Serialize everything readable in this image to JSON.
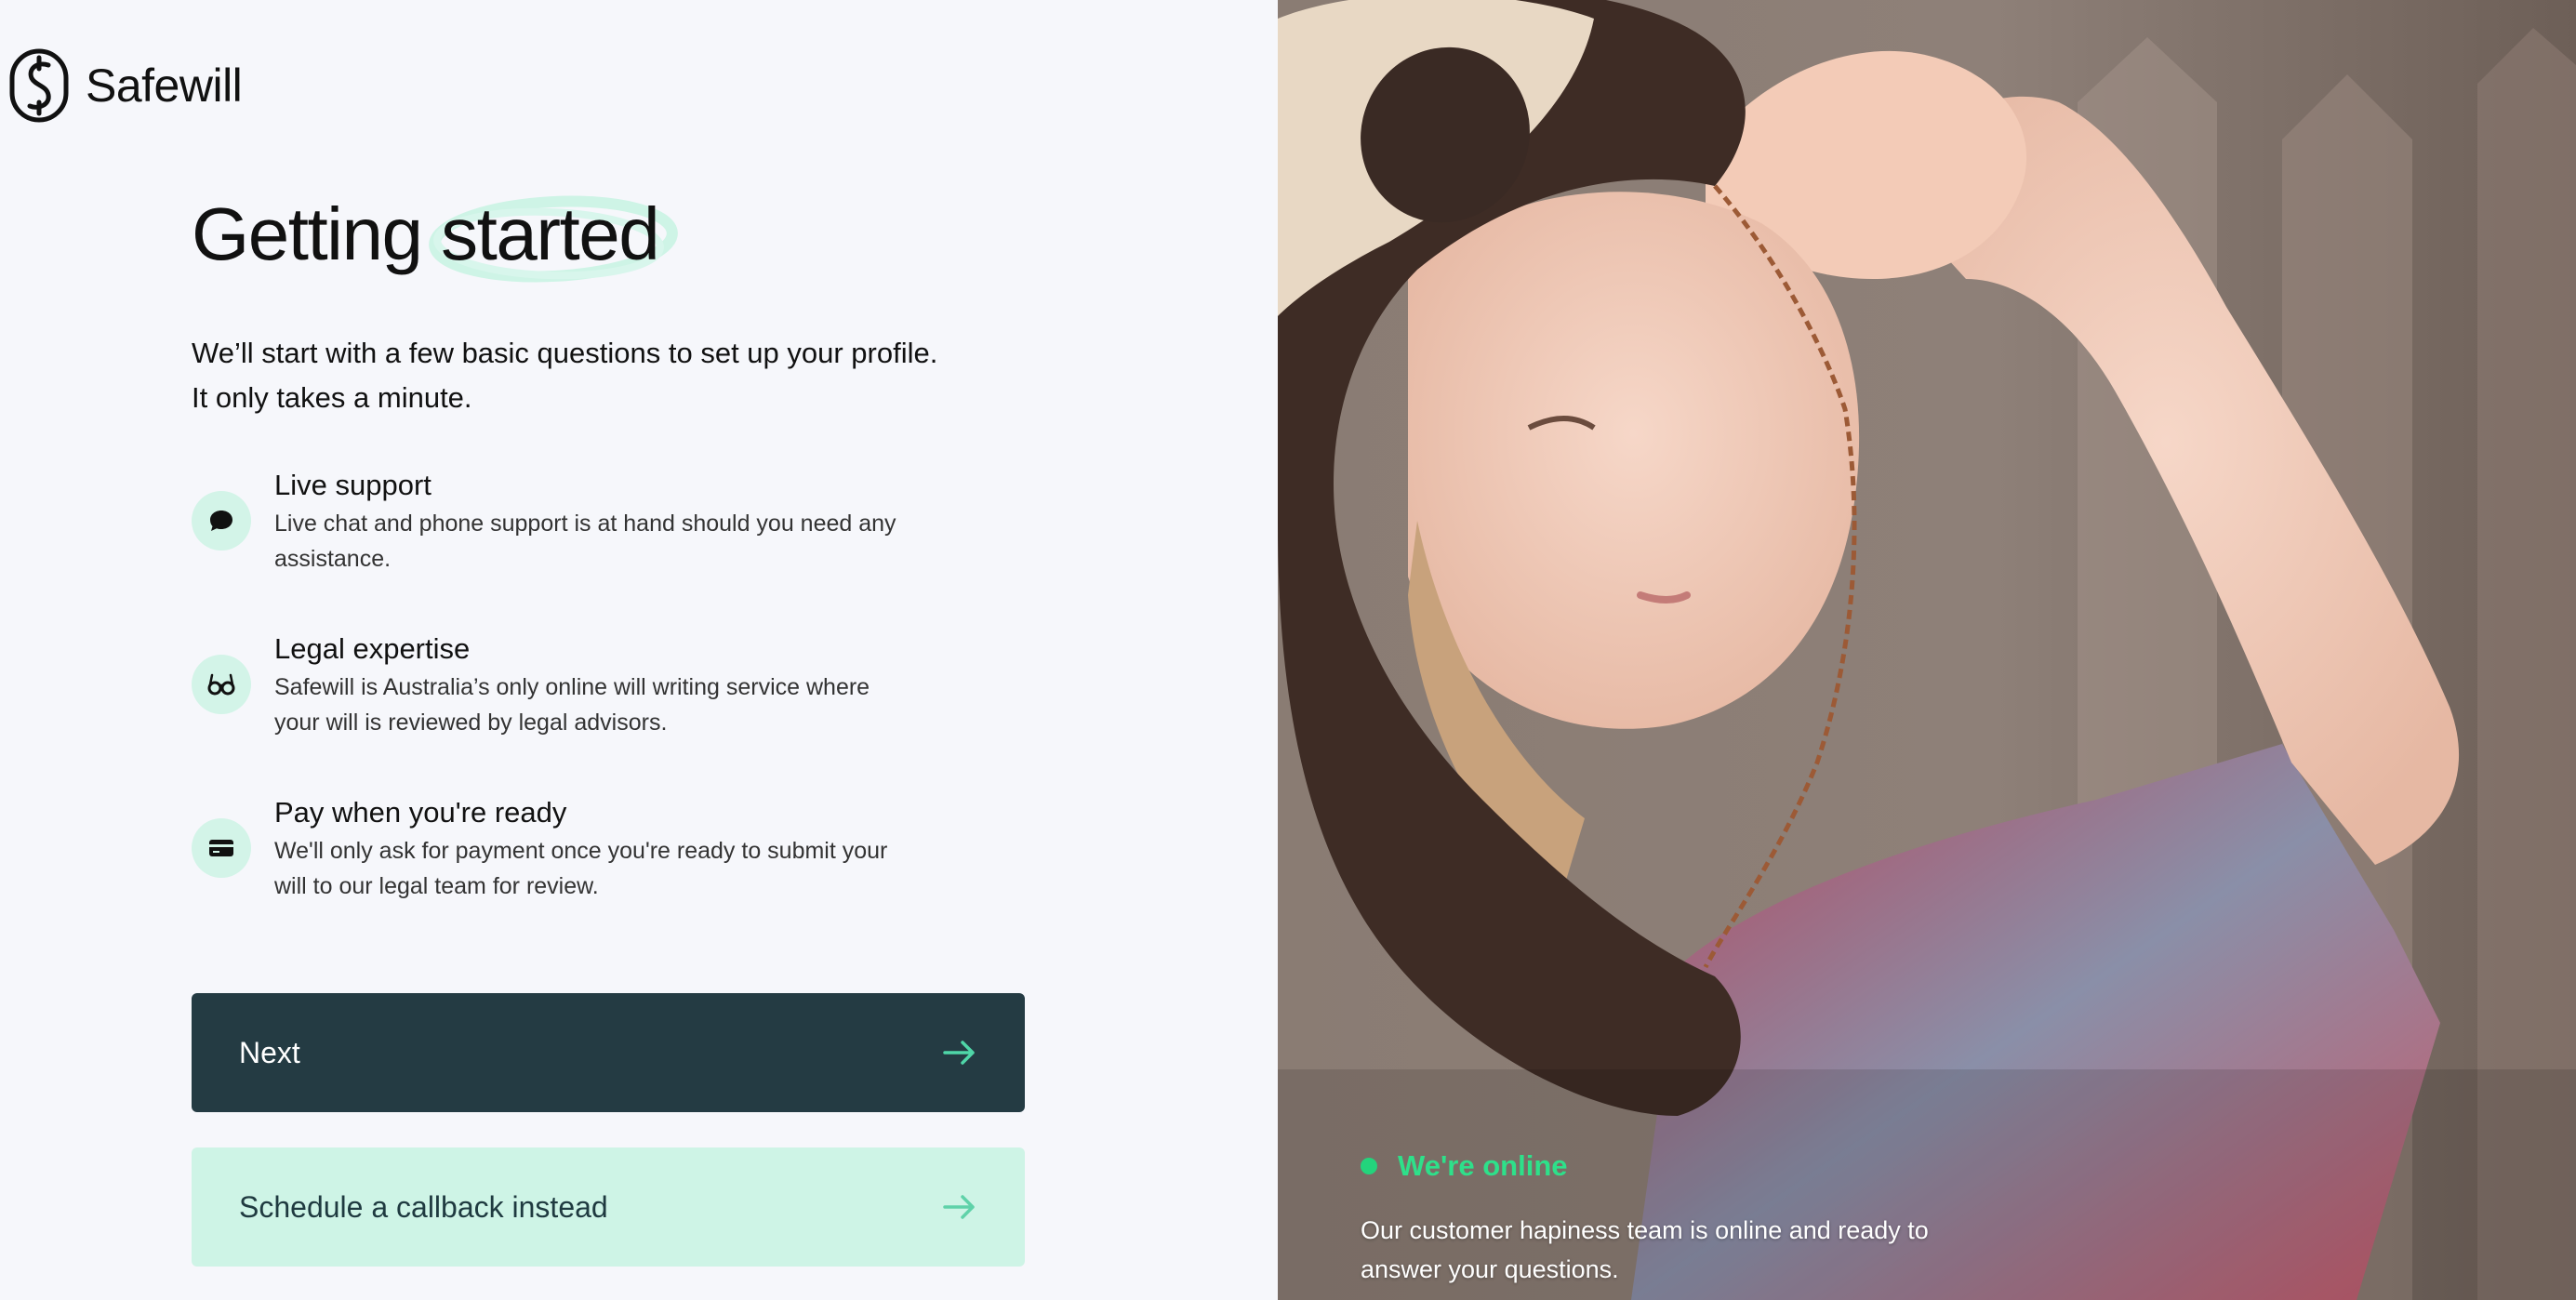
{
  "brand": {
    "name": "Safewill",
    "accent": "#cef4e6",
    "dark": "#243b43",
    "online_color": "#23d47c"
  },
  "heading": {
    "word1": "Getting",
    "word2": "started"
  },
  "intro": {
    "line1": "We’ll start with a few basic questions to set up your profile.",
    "line2": "It only takes a minute."
  },
  "features": [
    {
      "icon": "chat-bubble-icon",
      "title": "Live support",
      "desc": "Live chat and phone support is at hand should you need any assistance."
    },
    {
      "icon": "glasses-icon",
      "title": "Legal expertise",
      "desc": "Safewill is Australia’s only online will writing service where your will is reviewed by legal advisors."
    },
    {
      "icon": "credit-card-icon",
      "title": "Pay when you're ready",
      "desc": "We'll only ask for payment once you're ready to submit your will to our legal team for review."
    }
  ],
  "buttons": {
    "next": "Next",
    "callback": "Schedule a callback instead"
  },
  "status": {
    "label": "We're online",
    "desc": "Our customer hapiness team is online and ready to answer your questions."
  }
}
